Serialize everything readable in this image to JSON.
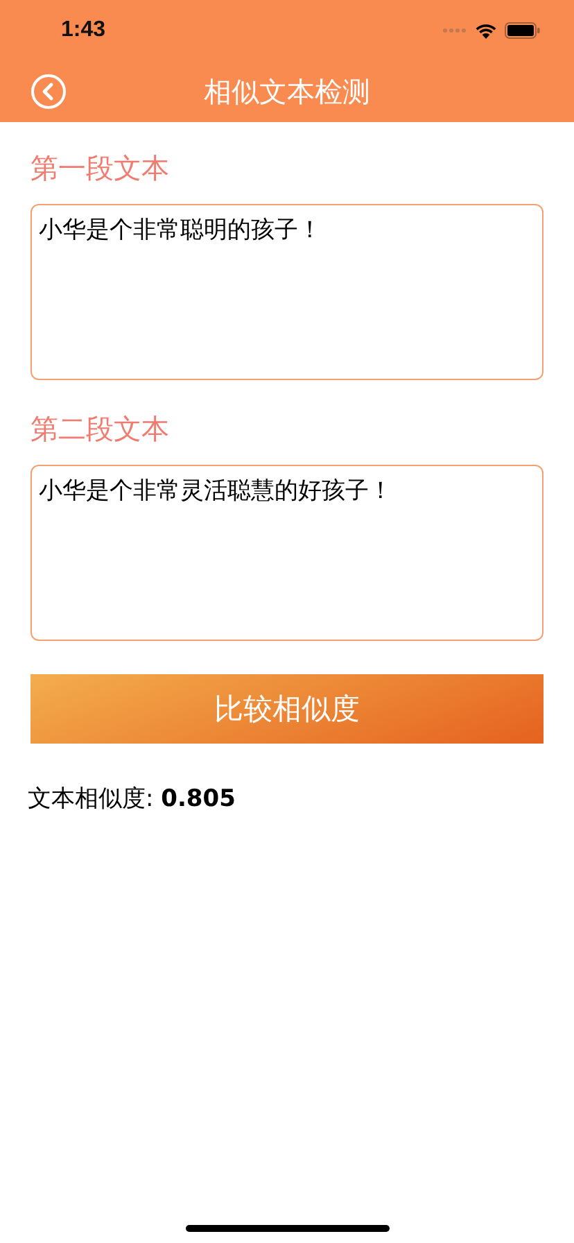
{
  "status_bar": {
    "time": "1:43"
  },
  "nav": {
    "title": "相似文本检测"
  },
  "fields": [
    {
      "label": "第一段文本",
      "value": "小华是个非常聪明的孩子！"
    },
    {
      "label": "第二段文本",
      "value": "小华是个非常灵活聪慧的好孩子！"
    }
  ],
  "compare_button": "比较相似度",
  "result": "文本相似度: **0.805**"
}
